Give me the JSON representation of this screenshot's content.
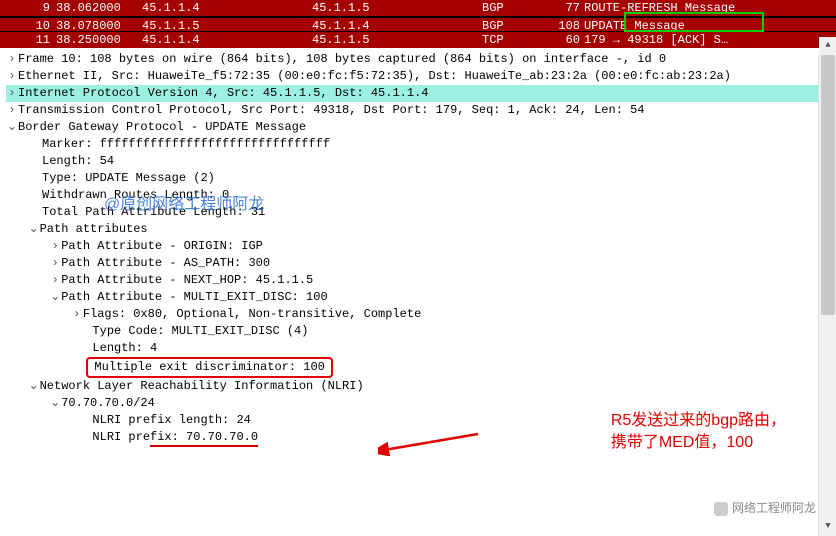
{
  "packet_list": {
    "rows": [
      {
        "num": "9",
        "time": "38.062000",
        "src": "45.1.1.4",
        "dst": "45.1.1.5",
        "proto": "BGP",
        "len": "77",
        "info": "ROUTE-REFRESH Message"
      },
      {
        "num": "10",
        "time": "38.078000",
        "src": "45.1.1.5",
        "dst": "45.1.1.4",
        "proto": "BGP",
        "len": "108",
        "info": "UPDATE Message"
      },
      {
        "num": "11",
        "time": "38.250000",
        "src": "45.1.1.4",
        "dst": "45.1.1.5",
        "proto": "TCP",
        "len": "60",
        "info": "179 → 49318 [ACK] S…"
      }
    ]
  },
  "details": {
    "frame": "Frame 10: 108 bytes on wire (864 bits), 108 bytes captured (864 bits) on interface -, id 0",
    "eth": "Ethernet II, Src: HuaweiTe_f5:72:35 (00:e0:fc:f5:72:35), Dst: HuaweiTe_ab:23:2a (00:e0:fc:ab:23:2a)",
    "ip": "Internet Protocol Version 4, Src: 45.1.1.5, Dst: 45.1.1.4",
    "tcp": "Transmission Control Protocol, Src Port: 49318, Dst Port: 179, Seq: 1, Ack: 24, Len: 54",
    "bgp": "Border Gateway Protocol - UPDATE Message",
    "marker": "Marker: ffffffffffffffffffffffffffffffff",
    "length": "Length: 54",
    "type": "Type: UPDATE Message (2)",
    "withdrawn": "Withdrawn Routes Length: 0",
    "tpal": "Total Path Attribute Length: 31",
    "pa": "Path attributes",
    "pa_origin": "Path Attribute - ORIGIN: IGP",
    "pa_aspath": "Path Attribute - AS_PATH: 300",
    "pa_nexthop": "Path Attribute - NEXT_HOP: 45.1.1.5",
    "pa_med": "Path Attribute - MULTI_EXIT_DISC: 100",
    "flags": "Flags: 0x80, Optional, Non-transitive, Complete",
    "typecode": "Type Code: MULTI_EXIT_DISC (4)",
    "attrlen": "Length: 4",
    "med": "Multiple exit discriminator: 100",
    "nlri_hdr": "Network Layer Reachability Information (NLRI)",
    "nlri_net": "70.70.70.0/24",
    "nlri_len": "NLRI prefix length: 24",
    "nlri_pfx_lbl": "NLRI pre",
    "nlri_pfx_lbl2": "fix: 70.70.70.0"
  },
  "watermark": "@原创网络工程师阿龙",
  "annotation": {
    "l1": "R5发送过来的bgp路由，",
    "l2": "携带了MED值，100"
  },
  "wechat": "网络工程师阿龙"
}
